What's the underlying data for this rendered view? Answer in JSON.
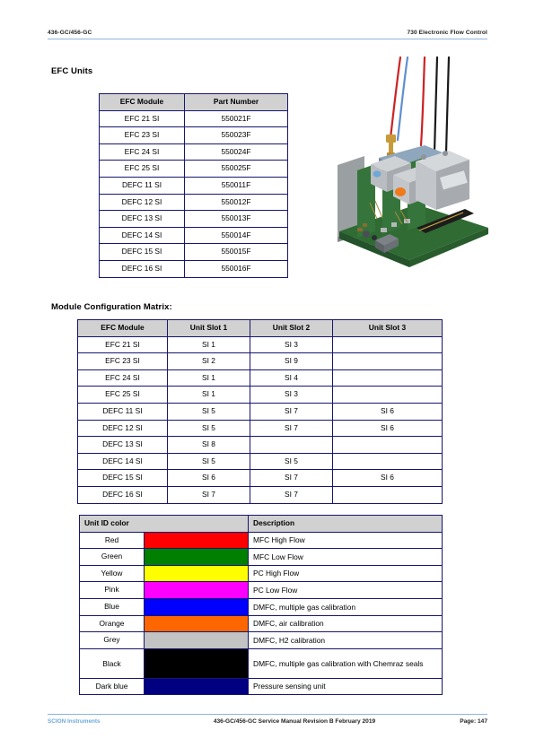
{
  "header": {
    "left": "436-GC/456-GC",
    "right": "730 Electronic Flow Control"
  },
  "headings": {
    "efc_units": "EFC Units",
    "module_matrix": "Module Configuration Matrix:"
  },
  "efc_units_table": {
    "columns": [
      "EFC Module",
      "Part Number"
    ],
    "rows": [
      [
        "EFC 21 SI",
        "550021F"
      ],
      [
        "EFC 23 SI",
        "550023F"
      ],
      [
        "EFC 24 SI",
        "550024F"
      ],
      [
        "EFC 25 SI",
        "550025F"
      ],
      [
        "DEFC 11 SI",
        "550011F"
      ],
      [
        "DEFC 12 SI",
        "550012F"
      ],
      [
        "DEFC 13 SI",
        "550013F"
      ],
      [
        "DEFC 14 SI",
        "550014F"
      ],
      [
        "DEFC 15 SI",
        "550015F"
      ],
      [
        "DEFC 16 SI",
        "550016F"
      ]
    ]
  },
  "module_matrix_table": {
    "columns": [
      "EFC Module",
      "Unit Slot 1",
      "Unit Slot 2",
      "Unit Slot 3"
    ],
    "rows": [
      [
        "EFC 21 SI",
        "SI 1",
        "SI 3",
        ""
      ],
      [
        "EFC 23 SI",
        "SI 2",
        "SI 9",
        ""
      ],
      [
        "EFC 24 SI",
        "SI 1",
        "SI 4",
        ""
      ],
      [
        "EFC 25 SI",
        "SI 1",
        "SI 3",
        ""
      ],
      [
        "DEFC 11 SI",
        "SI 5",
        "SI 7",
        "SI 6"
      ],
      [
        "DEFC 12 SI",
        "SI 5",
        "SI 7",
        "SI 6"
      ],
      [
        "DEFC 13 SI",
        "SI 8",
        "",
        ""
      ],
      [
        "DEFC 14 SI",
        "SI 5",
        "SI 5",
        ""
      ],
      [
        "DEFC 15 SI",
        "SI 6",
        "SI 7",
        "SI 6"
      ],
      [
        "DEFC 16 SI",
        "SI 7",
        "SI 7",
        ""
      ]
    ]
  },
  "unit_color_table": {
    "columns": [
      "Unit ID color",
      "Description"
    ],
    "rows": [
      {
        "name": "Red",
        "swatch": "#fe0000",
        "description": "MFC High Flow"
      },
      {
        "name": "Green",
        "swatch": "#007f00",
        "description": "MFC Low Flow"
      },
      {
        "name": "Yellow",
        "swatch": "#fefe00",
        "description": "PC High Flow"
      },
      {
        "name": "Pink",
        "swatch": "#fe00fe",
        "description": "PC Low Flow"
      },
      {
        "name": "Blue",
        "swatch": "#0000fe",
        "description": "DMFC, multiple gas calibration"
      },
      {
        "name": "Orange",
        "swatch": "#fe6600",
        "description": "DMFC, air calibration"
      },
      {
        "name": "Grey",
        "swatch": "#c3c3c3",
        "description": "DMFC, H2 calibration"
      },
      {
        "name": "Black",
        "swatch": "#000000",
        "description": "DMFC, multiple gas calibration with Chemraz seals",
        "tall": true
      },
      {
        "name": "Dark blue",
        "swatch": "#000080",
        "description": "Pressure sensing unit"
      }
    ]
  },
  "photo": {
    "caption": "EFC module assembly photograph",
    "wire_colors": [
      "#cc2222",
      "#5f8fd0",
      "#cc2222",
      "#1a1a1a",
      "#1a1a1a"
    ],
    "pcb_color": "#2f6b33",
    "block_color": "#b9bcc0",
    "chassis_color": "#9aa0a2",
    "indicator_color": "#f07a1a",
    "fitting_color": "#c79a3a"
  },
  "footer": {
    "left": "SCION Instruments",
    "center": "436-GC/456-GC Service Manual Revision B February 2019",
    "right": "Page: 147"
  },
  "theme": {
    "rule_color": "#8db4e2",
    "table_border": "#16166e",
    "table_header_bg": "#d1d1d1",
    "footer_brand_color": "#6fa8dc"
  }
}
